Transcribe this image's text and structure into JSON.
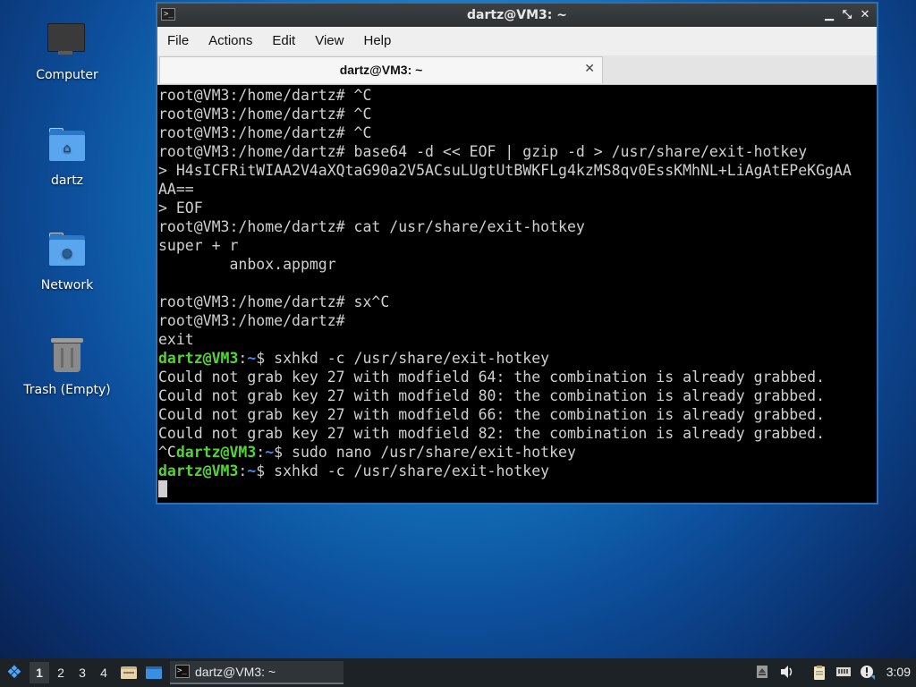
{
  "desktop": {
    "icons": [
      {
        "label": "Computer",
        "icon": "computer-icon"
      },
      {
        "label": "dartz",
        "icon": "home-folder-icon"
      },
      {
        "label": "Network",
        "icon": "network-folder-icon"
      },
      {
        "label": "Trash (Empty)",
        "icon": "trash-icon"
      }
    ]
  },
  "window": {
    "title": "dartz@VM3: ~",
    "controls": {
      "minimize": "▁",
      "maximize": "⤡",
      "close": "✕"
    },
    "menu": [
      "File",
      "Actions",
      "Edit",
      "View",
      "Help"
    ],
    "tab": {
      "title": "dartz@VM3: ~",
      "close": "✕"
    }
  },
  "terminal": {
    "lines": [
      {
        "segments": [
          {
            "t": "root@VM3:/home/dartz# ^C"
          }
        ]
      },
      {
        "segments": [
          {
            "t": "root@VM3:/home/dartz# ^C"
          }
        ]
      },
      {
        "segments": [
          {
            "t": "root@VM3:/home/dartz# ^C"
          }
        ]
      },
      {
        "segments": [
          {
            "t": "root@VM3:/home/dartz# base64 -d << EOF | gzip -d > /usr/share/exit-hotkey"
          }
        ]
      },
      {
        "segments": [
          {
            "t": "> H4sICFRitWIAA2V4aXQtaG90a2V5ACsuLUgtUtBWKFLg4kzMS8qv0EssKMhNL+LiAgAtEPeKGgAA"
          }
        ]
      },
      {
        "segments": [
          {
            "t": "AA=="
          }
        ]
      },
      {
        "segments": [
          {
            "t": "> EOF"
          }
        ]
      },
      {
        "segments": [
          {
            "t": "root@VM3:/home/dartz# cat /usr/share/exit-hotkey"
          }
        ]
      },
      {
        "segments": [
          {
            "t": "super + r"
          }
        ]
      },
      {
        "segments": [
          {
            "t": "        anbox.appmgr"
          }
        ]
      },
      {
        "segments": [
          {
            "t": ""
          }
        ]
      },
      {
        "segments": [
          {
            "t": "root@VM3:/home/dartz# sx^C"
          }
        ]
      },
      {
        "segments": [
          {
            "t": "root@VM3:/home/dartz#"
          }
        ]
      },
      {
        "segments": [
          {
            "t": "exit"
          }
        ]
      },
      {
        "segments": [
          {
            "t": "dartz@VM3",
            "c": "user"
          },
          {
            "t": ":"
          },
          {
            "t": "~",
            "c": "path"
          },
          {
            "t": "$ sxhkd -c /usr/share/exit-hotkey"
          }
        ]
      },
      {
        "segments": [
          {
            "t": "Could not grab key 27 with modfield 64: the combination is already grabbed."
          }
        ]
      },
      {
        "segments": [
          {
            "t": "Could not grab key 27 with modfield 80: the combination is already grabbed."
          }
        ]
      },
      {
        "segments": [
          {
            "t": "Could not grab key 27 with modfield 66: the combination is already grabbed."
          }
        ]
      },
      {
        "segments": [
          {
            "t": "Could not grab key 27 with modfield 82: the combination is already grabbed."
          }
        ]
      },
      {
        "segments": [
          {
            "t": "^C"
          },
          {
            "t": "dartz@VM3",
            "c": "user"
          },
          {
            "t": ":"
          },
          {
            "t": "~",
            "c": "path"
          },
          {
            "t": "$ sudo nano /usr/share/exit-hotkey"
          }
        ]
      },
      {
        "segments": [
          {
            "t": "dartz@VM3",
            "c": "user"
          },
          {
            "t": ":"
          },
          {
            "t": "~",
            "c": "path"
          },
          {
            "t": "$ sxhkd -c /usr/share/exit-hotkey"
          }
        ]
      }
    ],
    "colors": {
      "user": "#55d436",
      "path": "#3b8ef0",
      "text": "#d0d0d0",
      "background": "#000000"
    }
  },
  "taskbar": {
    "start_icon": "lubuntu-menu-icon",
    "workspaces": [
      "1",
      "2",
      "3",
      "4"
    ],
    "active_workspace": "1",
    "task": {
      "label": "dartz@VM3: ~"
    },
    "tray": [
      "eject-icon",
      "volume-icon",
      "clipboard-icon",
      "network-icon",
      "update-notifier-icon"
    ],
    "clock": "3:09"
  }
}
